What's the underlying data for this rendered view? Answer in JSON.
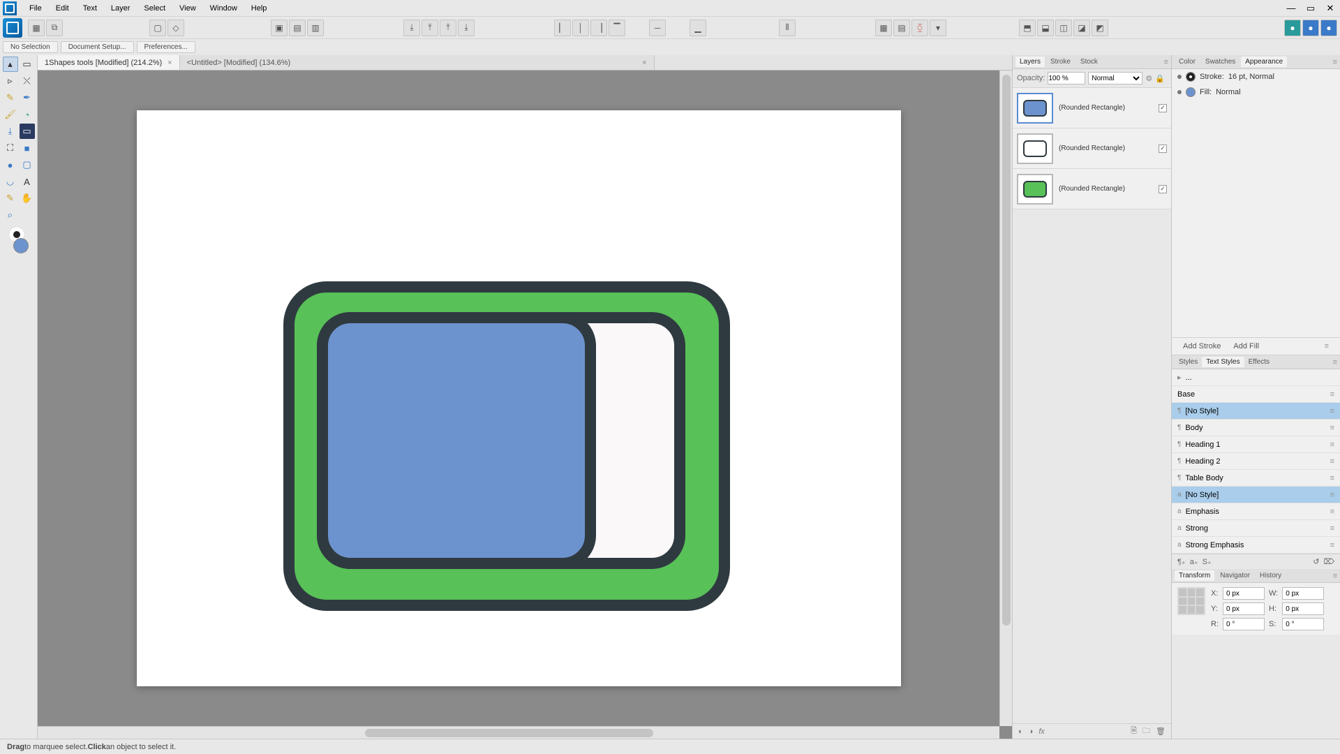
{
  "menu": {
    "file": "File",
    "edit": "Edit",
    "text": "Text",
    "layer": "Layer",
    "select": "Select",
    "view": "View",
    "window": "Window",
    "help": "Help"
  },
  "option_bar": {
    "no_selection": "No Selection",
    "doc_setup": "Document Setup...",
    "prefs": "Preferences..."
  },
  "tabs": {
    "active": "1Shapes tools [Modified] (214.2%)",
    "inactive": "<Untitled> [Modified] (134.6%)"
  },
  "layers_panel": {
    "tab_layers": "Layers",
    "tab_stroke": "Stroke",
    "tab_stock": "Stock",
    "opacity_label": "Opacity:",
    "opacity_value": "100 %",
    "blend_mode": "Normal",
    "items": [
      {
        "name": "(Rounded Rectangle)",
        "fill": "#6d93ce"
      },
      {
        "name": "(Rounded Rectangle)",
        "fill": "#ffffff"
      },
      {
        "name": "(Rounded Rectangle)",
        "fill": "#58c158"
      }
    ]
  },
  "appearance_panel": {
    "tab_color": "Color",
    "tab_swatches": "Swatches",
    "tab_appearance": "Appearance",
    "stroke_label": "Stroke:",
    "stroke_value": "16 pt,  Normal",
    "fill_label": "Fill:",
    "fill_value": "Normal",
    "add_stroke": "Add Stroke",
    "add_fill": "Add Fill"
  },
  "styles_panel": {
    "tab_styles": "Styles",
    "tab_text_styles": "Text Styles",
    "tab_effects": "Effects",
    "crumb": "...",
    "base": "Base",
    "items": [
      {
        "label": "[No Style]",
        "kind": "p",
        "sel": true
      },
      {
        "label": "Body",
        "kind": "p"
      },
      {
        "label": "Heading 1",
        "kind": "p"
      },
      {
        "label": "Heading 2",
        "kind": "p"
      },
      {
        "label": "Table Body",
        "kind": "p"
      },
      {
        "label": "[No Style]",
        "kind": "c",
        "sel": true
      },
      {
        "label": "Emphasis",
        "kind": "c"
      },
      {
        "label": "Strong",
        "kind": "c"
      },
      {
        "label": "Strong Emphasis",
        "kind": "c"
      }
    ]
  },
  "transform_panel": {
    "tab_transform": "Transform",
    "tab_navigator": "Navigator",
    "tab_history": "History",
    "x_label": "X:",
    "y_label": "Y:",
    "w_label": "W:",
    "h_label": "H:",
    "r_label": "R:",
    "s_label": "S:",
    "x": "0 px",
    "y": "0 px",
    "w": "0 px",
    "h": "0 px",
    "r": "0 °",
    "s": "0 °"
  },
  "status": {
    "drag": "Drag",
    "drag_rest": " to marquee select. ",
    "click": "Click",
    "click_rest": " an object to select it."
  },
  "colors": {
    "green": "#58c158",
    "blue": "#6d93ce",
    "outline": "#2f3a40"
  }
}
